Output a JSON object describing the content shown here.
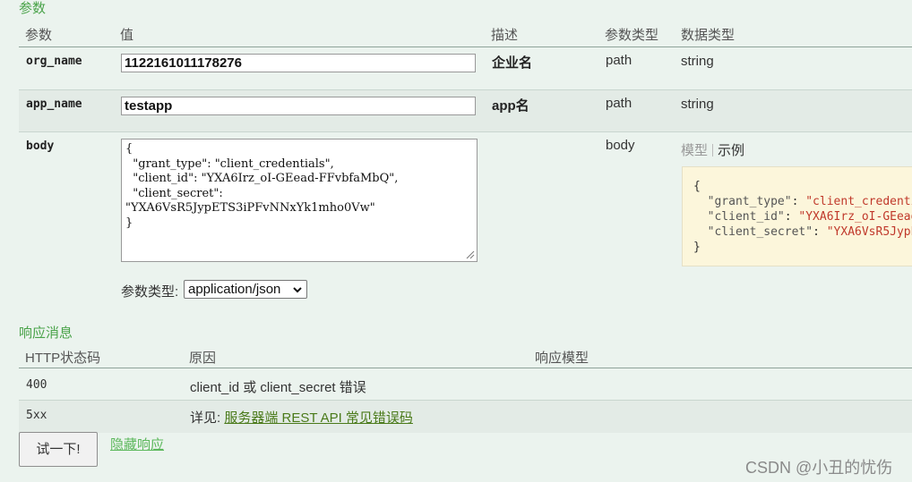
{
  "params_section": {
    "title": "参数",
    "columns": [
      "参数",
      "值",
      "描述",
      "参数类型",
      "数据类型"
    ],
    "rows": [
      {
        "name": "org_name",
        "value": "1122161011178276",
        "description": "企业名",
        "param_type": "path",
        "data_type": "string"
      },
      {
        "name": "app_name",
        "value": "testapp",
        "description": "app名",
        "param_type": "path",
        "data_type": "string"
      },
      {
        "name": "body",
        "param_type": "body",
        "value": "{\n  \"grant_type\": \"client_credentials\",\n  \"client_id\": \"YXA6Irz_oI-GEead-FFvbfaMbQ\",\n  \"client_secret\": \"YXA6VsR5JypETS3iPFvNNxYk1mho0Vw\"\n}",
        "tabs": {
          "model": "模型",
          "example": "示例"
        }
      }
    ],
    "content_type_label": "参数类型:",
    "content_type_value": "application/json"
  },
  "response_section": {
    "title": "响应消息",
    "columns": [
      "HTTP状态码",
      "原因",
      "响应模型"
    ],
    "rows": [
      {
        "code": "400",
        "reason": "client_id 或 client_secret 错误"
      },
      {
        "code": "5xx",
        "reason_prefix": "详见:",
        "reason_link": "服务器端 REST API 常见错误码"
      }
    ]
  },
  "actions": {
    "try_button": "试一下!",
    "hide_response_link": "隐藏响应"
  },
  "watermark": "CSDN @小丑的忧伤",
  "colors": {
    "accent_green": "#4aa34a",
    "string_red": "#c0392b",
    "sample_bg": "#fcf6db"
  }
}
